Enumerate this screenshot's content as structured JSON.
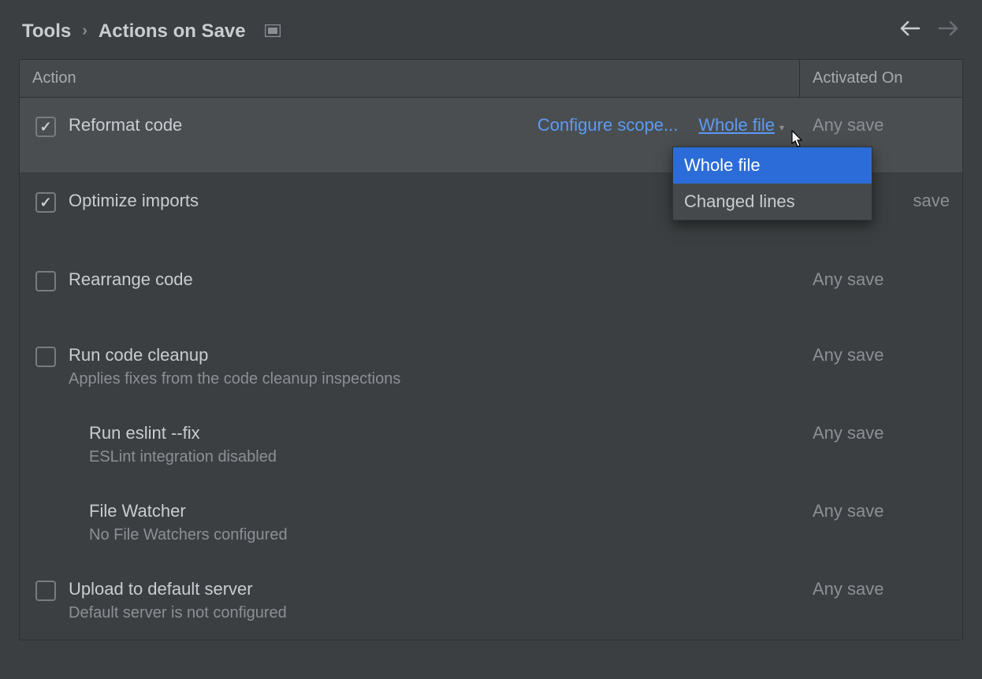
{
  "breadcrumb": {
    "parent": "Tools",
    "current": "Actions on Save"
  },
  "columns": {
    "action": "Action",
    "activated": "Activated On"
  },
  "rows": {
    "reformat": {
      "title": "Reformat code",
      "configure": "Configure scope...",
      "scope": "Whole file",
      "activated": "Any save"
    },
    "optimize": {
      "title": "Optimize imports",
      "activated": "save"
    },
    "rearrange": {
      "title": "Rearrange code",
      "activated": "Any save"
    },
    "cleanup": {
      "title": "Run code cleanup",
      "sub": "Applies fixes from the code cleanup inspections",
      "activated": "Any save"
    },
    "eslint": {
      "title": "Run eslint --fix",
      "sub": "ESLint integration disabled",
      "activated": "Any save"
    },
    "filewatcher": {
      "title": "File Watcher",
      "sub": "No File Watchers configured",
      "activated": "Any save"
    },
    "upload": {
      "title": "Upload to default server",
      "sub": "Default server is not configured",
      "activated": "Any save"
    }
  },
  "dropdown": {
    "whole": "Whole file",
    "changed": "Changed lines"
  }
}
